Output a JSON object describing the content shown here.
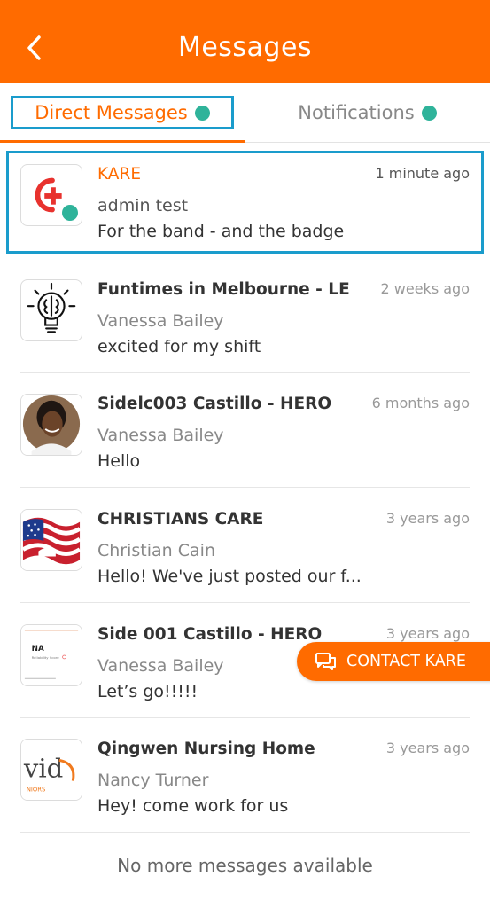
{
  "header": {
    "title": "Messages"
  },
  "tabs": [
    {
      "label": "Direct Messages",
      "active": true,
      "has_dot": true
    },
    {
      "label": "Notifications",
      "active": false,
      "has_dot": true
    }
  ],
  "messages": [
    {
      "title": "KARE",
      "time": "1 minute ago",
      "sender": "admin test",
      "preview": "For the band - and the badge",
      "avatar": "kare-logo",
      "unread": true
    },
    {
      "title": "Funtimes in Melbourne - LE",
      "time": "2 weeks ago",
      "sender": "Vanessa Bailey",
      "preview": "excited for my shift",
      "avatar": "lightbulb-brain-logo"
    },
    {
      "title": "Sidelc003 Castillo - HERO",
      "time": "6 months ago",
      "sender": "Vanessa Bailey",
      "preview": "Hello",
      "avatar": "person-photo"
    },
    {
      "title": "CHRISTIANS CARE",
      "time": "3 years ago",
      "sender": "Christian Cain",
      "preview": "Hello! We've just posted our f...",
      "avatar": "flag-logo"
    },
    {
      "title": "Side 001 Castillo - HERO",
      "time": "3 years ago",
      "sender": "Vanessa Bailey",
      "preview": "Let’s go!!!!!",
      "avatar": "document-thumbnail",
      "avatar_text": "NA",
      "avatar_subtext": "Reliability Score"
    },
    {
      "title": "Qingwen Nursing Home",
      "time": "3 years ago",
      "sender": "Nancy Turner",
      "preview": "Hey! come work for us",
      "avatar": "vid-logo",
      "avatar_text": "vid",
      "avatar_subtext": "NIORS"
    }
  ],
  "footer": {
    "text": "No more messages available"
  },
  "contact_button": {
    "label": "CONTACT KARE"
  },
  "colors": {
    "brand_orange": "#ff6b00",
    "unread_teal": "#2fb39a",
    "highlight_blue": "#1a9ccc"
  }
}
